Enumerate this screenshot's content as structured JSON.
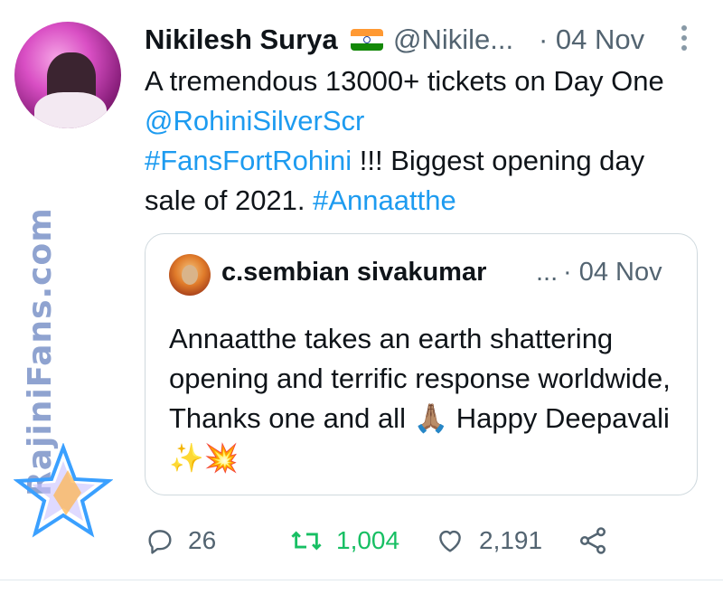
{
  "tweet": {
    "author_name": "Nikilesh Surya",
    "author_flag": "🇮🇳",
    "handle": "@Nikile...",
    "date": "· 04 Nov",
    "text_parts": [
      "A tremendous 13000+ tickets on Day One ",
      "@RohiniSilverScr",
      " ",
      "#FansFortRohini",
      " !!! Biggest opening day sale of 2021. ",
      "#Annaatthe"
    ]
  },
  "quoted_tweet": {
    "author_name": "c.sembian sivakumar",
    "ellipsis": "...",
    "date": "· 04 Nov",
    "text": "Annaatthe takes an earth shattering opening and terrific response worldwide, Thanks one and all 🙏🏽 Happy Deepavali ✨💥"
  },
  "actions": {
    "replies": "26",
    "retweets": "1,004",
    "likes": "2,191"
  },
  "icons": {
    "reply": "reply-icon",
    "retweet": "retweet-icon",
    "like": "heart-icon",
    "share": "share-icon",
    "more": "more-vertical-icon"
  },
  "colors": {
    "link": "#1d9bf0",
    "retweet_active": "#17bf63",
    "muted": "#536471"
  },
  "watermark": {
    "text": "RajiniFans.com"
  }
}
